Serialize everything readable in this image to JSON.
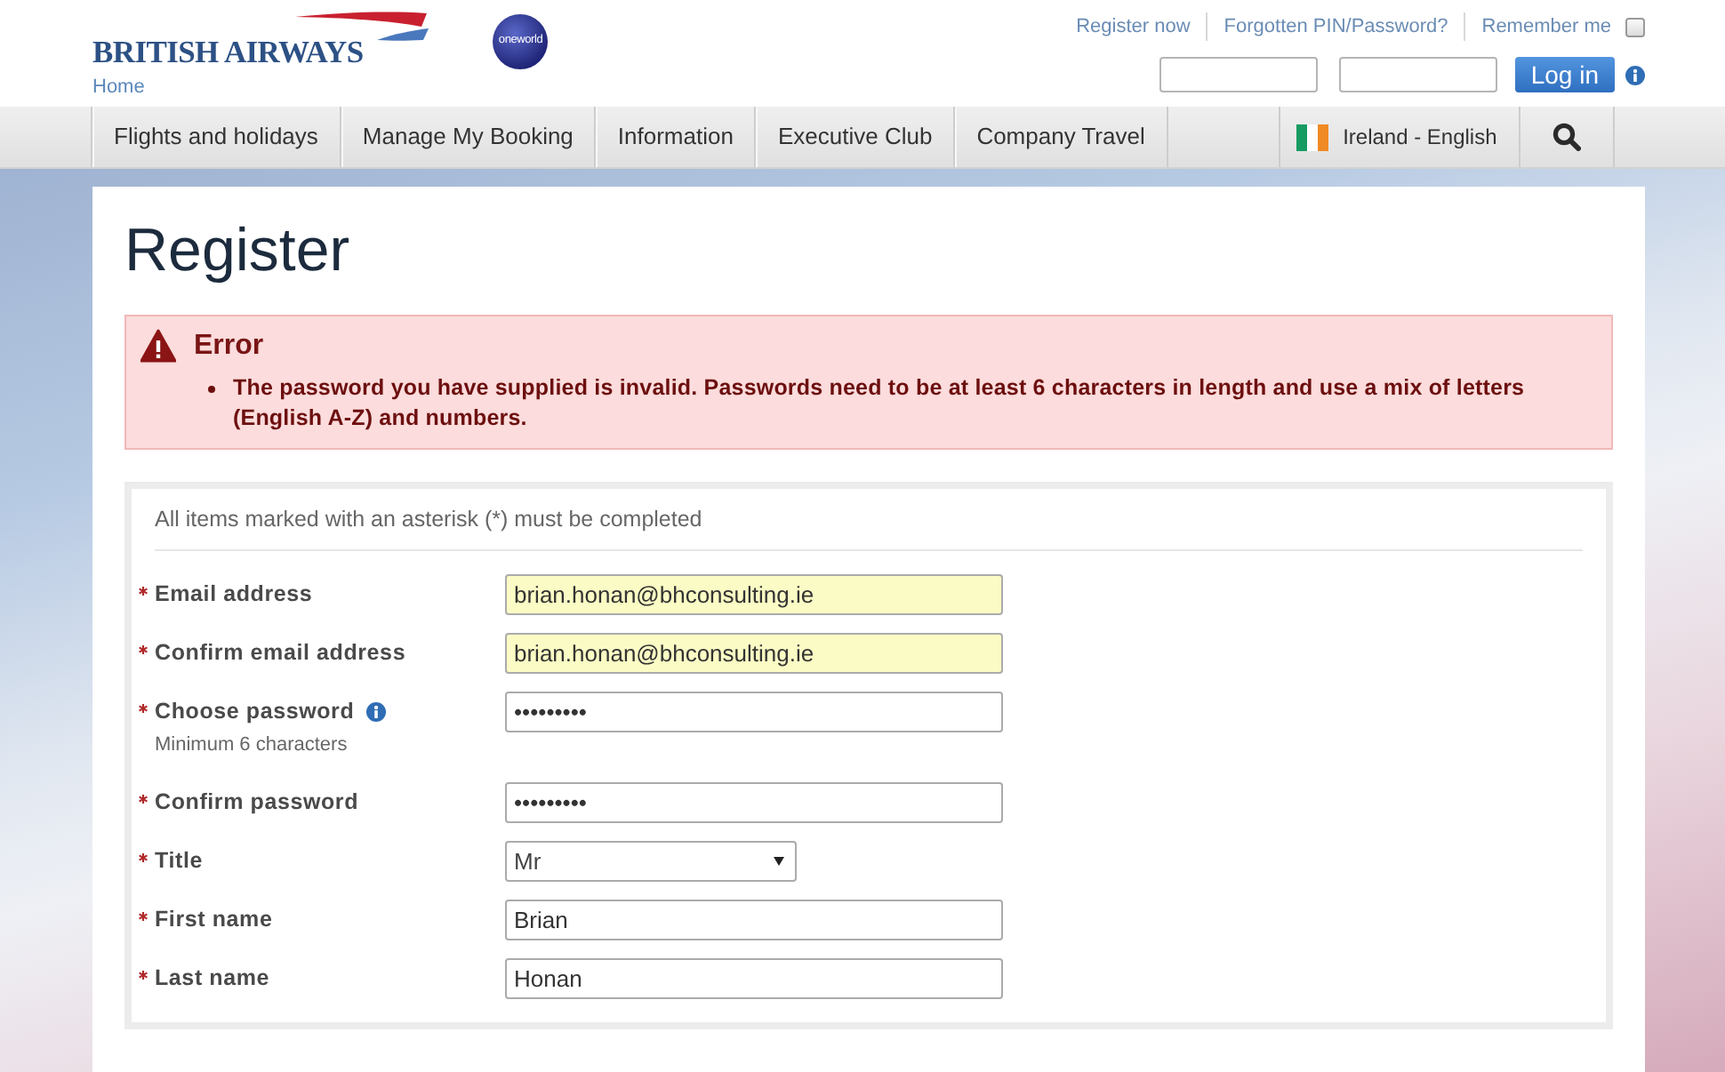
{
  "header": {
    "logo_text": "BRITISH AIRWAYS",
    "partner_logo_text": "oneworld",
    "home_link": "Home",
    "top_links": [
      "Register now",
      "Forgotten PIN/Password?"
    ],
    "remember_me": {
      "label": "Remember me",
      "checked": false
    },
    "login_button": "Log in"
  },
  "nav": {
    "items": [
      {
        "label": "Flights and holidays",
        "selected": false
      },
      {
        "label": "Manage My Booking",
        "selected": false
      },
      {
        "label": "Information",
        "selected": false
      },
      {
        "label": "Executive Club",
        "selected": false
      },
      {
        "label": "Company Travel",
        "selected": false
      }
    ],
    "locale": "Ireland - English"
  },
  "page": {
    "title": "Register",
    "error": {
      "title": "Error",
      "messages": [
        "The password you have supplied is invalid. Passwords need to be at least 6 characters in length and use a mix of letters (English A-Z) and numbers."
      ]
    },
    "form": {
      "note": "All items marked with an asterisk (*) must be completed",
      "fields": [
        {
          "label": "Email address",
          "required": true,
          "info": false,
          "kind": "text",
          "value": "brian.honan@bhconsulting.ie",
          "autofilled": true
        },
        {
          "label": "Confirm email address",
          "required": true,
          "info": false,
          "kind": "text",
          "value": "brian.honan@bhconsulting.ie",
          "autofilled": true
        },
        {
          "label": "Choose password",
          "required": true,
          "info": true,
          "hint": "Minimum 6 characters",
          "kind": "text",
          "value": "•••••••••",
          "autofilled": false
        },
        {
          "label": "Confirm password",
          "required": true,
          "info": false,
          "kind": "text",
          "value": "•••••••••",
          "autofilled": false
        },
        {
          "label": "Title",
          "required": true,
          "info": false,
          "kind": "select",
          "value": "Mr",
          "autofilled": false
        },
        {
          "label": "First name",
          "required": true,
          "info": false,
          "kind": "text",
          "value": "Brian",
          "autofilled": false
        },
        {
          "label": "Last name",
          "required": true,
          "info": false,
          "kind": "text",
          "value": "Honan",
          "autofilled": false
        }
      ]
    }
  }
}
